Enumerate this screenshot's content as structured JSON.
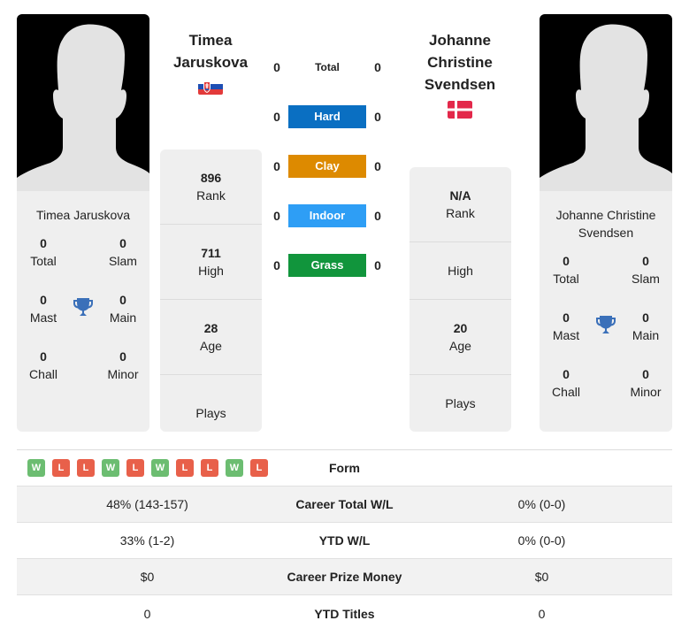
{
  "colors": {
    "hard": "#0a6fc2",
    "clay": "#dd8a00",
    "indoor": "#2e9ef5",
    "grass": "#11953c",
    "win": "#6cbd71",
    "loss": "#e8604a",
    "trophy": "#3b70b9"
  },
  "player1": {
    "name": "Timea Jaruskova",
    "header_name_lines": [
      "Timea",
      "Jaruskova"
    ],
    "flag": "slovakia-flag",
    "card_name": "Timea Jaruskova",
    "titles": {
      "total": {
        "value": "0",
        "label": "Total"
      },
      "slam": {
        "value": "0",
        "label": "Slam"
      },
      "mast": {
        "value": "0",
        "label": "Mast"
      },
      "main": {
        "value": "0",
        "label": "Main"
      },
      "chall": {
        "value": "0",
        "label": "Chall"
      },
      "minor": {
        "value": "0",
        "label": "Minor"
      }
    },
    "stats": [
      {
        "value": "896",
        "label": "Rank"
      },
      {
        "value": "711",
        "label": "High"
      },
      {
        "value": "28",
        "label": "Age"
      },
      {
        "value": "",
        "label": "Plays"
      }
    ]
  },
  "player2": {
    "name": "Johanne Christine Svendsen",
    "header_name_lines": [
      "Johanne",
      "Christine",
      "Svendsen"
    ],
    "flag": "denmark-flag",
    "card_name_lines": [
      "Johanne Christine",
      "Svendsen"
    ],
    "titles": {
      "total": {
        "value": "0",
        "label": "Total"
      },
      "slam": {
        "value": "0",
        "label": "Slam"
      },
      "mast": {
        "value": "0",
        "label": "Mast"
      },
      "main": {
        "value": "0",
        "label": "Main"
      },
      "chall": {
        "value": "0",
        "label": "Chall"
      },
      "minor": {
        "value": "0",
        "label": "Minor"
      }
    },
    "stats": [
      {
        "value": "N/A",
        "label": "Rank"
      },
      {
        "value": "",
        "label": "High"
      },
      {
        "value": "20",
        "label": "Age"
      },
      {
        "value": "",
        "label": "Plays"
      }
    ]
  },
  "surfaces": [
    {
      "label": "Total",
      "p1": "0",
      "p2": "0",
      "color": ""
    },
    {
      "label": "Hard",
      "p1": "0",
      "p2": "0",
      "color": "#0a6fc2"
    },
    {
      "label": "Clay",
      "p1": "0",
      "p2": "0",
      "color": "#dd8a00"
    },
    {
      "label": "Indoor",
      "p1": "0",
      "p2": "0",
      "color": "#2e9ef5"
    },
    {
      "label": "Grass",
      "p1": "0",
      "p2": "0",
      "color": "#11953c"
    }
  ],
  "comparison": {
    "form_label": "Form",
    "p1_form": [
      "W",
      "L",
      "L",
      "W",
      "L",
      "W",
      "L",
      "L",
      "W",
      "L"
    ],
    "rows": [
      {
        "label": "Career Total W/L",
        "p1": "48% (143-157)",
        "p2": "0% (0-0)"
      },
      {
        "label": "YTD W/L",
        "p1": "33% (1-2)",
        "p2": "0% (0-0)"
      },
      {
        "label": "Career Prize Money",
        "p1": "$0",
        "p2": "$0"
      },
      {
        "label": "YTD Titles",
        "p1": "0",
        "p2": "0"
      }
    ]
  }
}
